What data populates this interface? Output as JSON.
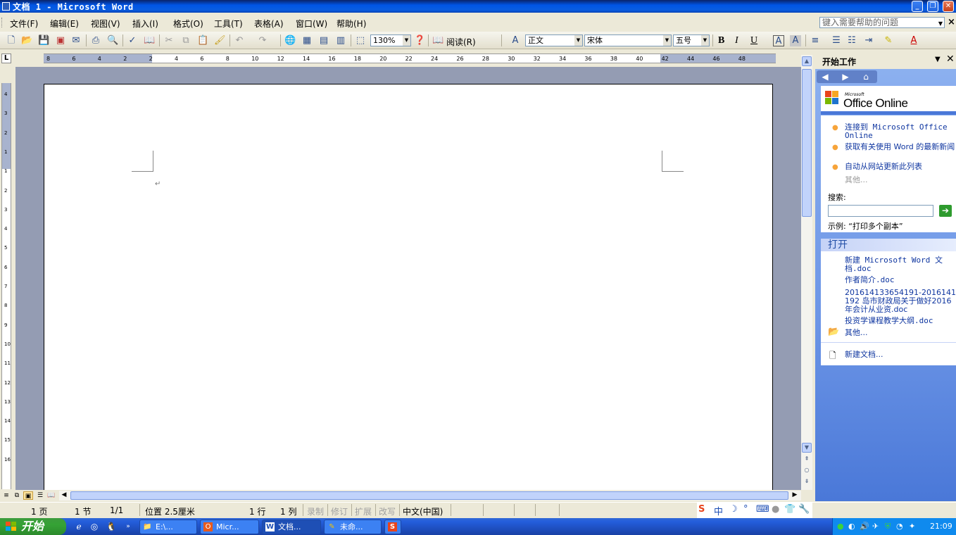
{
  "window": {
    "title": "文档 1 - Microsoft Word"
  },
  "menu": {
    "items": [
      "文件(F)",
      "编辑(E)",
      "视图(V)",
      "插入(I)",
      "格式(O)",
      "工具(T)",
      "表格(A)",
      "窗口(W)",
      "帮助(H)"
    ],
    "help_placeholder": "键入需要帮助的问题",
    "close_glyph": "×"
  },
  "toolbar": {
    "zoom": "130%",
    "read_label": "阅读(R)",
    "style": "正文",
    "font": "宋体",
    "size": "五号",
    "bold": "B",
    "italic": "I",
    "underline": "U"
  },
  "ruler": {
    "h_ticks": [
      "8",
      "6",
      "4",
      "2",
      "2",
      "4",
      "6",
      "8",
      "10",
      "12",
      "14",
      "16",
      "18",
      "20",
      "22",
      "24",
      "26",
      "28",
      "30",
      "32",
      "34",
      "36",
      "38",
      "40",
      "42",
      "44",
      "46",
      "48"
    ],
    "v_ticks": [
      "4",
      "3",
      "2",
      "1",
      "1",
      "2",
      "3",
      "4",
      "5",
      "6",
      "7",
      "8",
      "9",
      "10",
      "11",
      "12",
      "13",
      "14",
      "15",
      "16"
    ],
    "corner": "L"
  },
  "document": {
    "para_mark": "↵"
  },
  "taskpane": {
    "title": "开始工作",
    "logo_small": "Microsoft",
    "logo": "Office Online",
    "links": [
      "连接到 Microsoft Office Online",
      "获取有关使用 Word 的最新新闻",
      "自动从网站更新此列表"
    ],
    "more": "其他...",
    "search_label": "搜索:",
    "example": "示例: “打印多个副本”",
    "open_section": "打开",
    "files": [
      "新建 Microsoft Word 文档.doc",
      "作者简介.doc",
      "201614133654191-2016141192 岛市财政局关于做好2016年会计从业资.doc",
      "投资学课程教学大纲.doc"
    ],
    "open_more": "其他...",
    "new_doc": "新建文档..."
  },
  "status": {
    "page": "1 页",
    "section": "1 节",
    "pages": "1/1",
    "position": "位置 2.5厘米",
    "line": "1 行",
    "column": "1 列",
    "rec": "录制",
    "trk": "修订",
    "ext": "扩展",
    "ovr": "改写",
    "lang": "中文(中国)"
  },
  "taskbar": {
    "start": "开始",
    "tasks": [
      "E:\\...",
      "Micr...",
      "文档...",
      "未命..."
    ],
    "clock": "21:09"
  }
}
